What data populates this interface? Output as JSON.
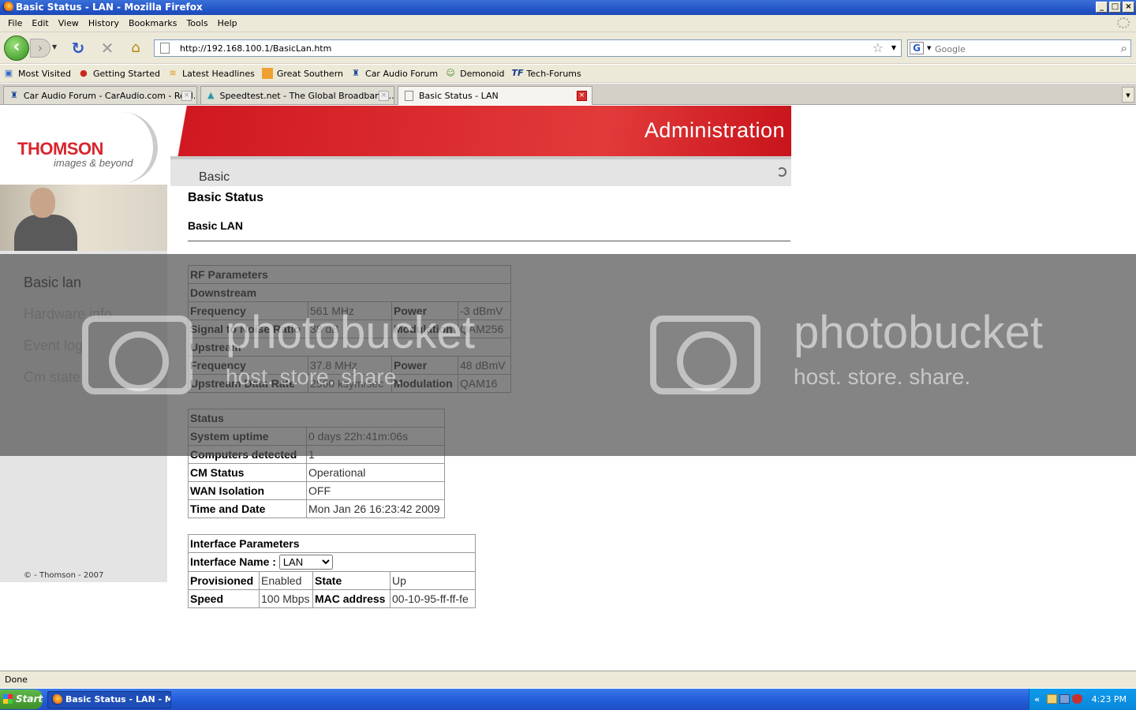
{
  "window": {
    "title": "Basic Status - LAN - Mozilla Firefox"
  },
  "menu": [
    "File",
    "Edit",
    "View",
    "History",
    "Bookmarks",
    "Tools",
    "Help"
  ],
  "address": {
    "url": "http://192.168.100.1/BasicLan.htm"
  },
  "search": {
    "placeholder": "Google"
  },
  "bookmarks": [
    "Most Visited",
    "Getting Started",
    "Latest Headlines",
    "Great Southern",
    "Car Audio Forum",
    "Demonoid",
    "Tech-Forums"
  ],
  "tabs": [
    "Car Audio Forum - CarAudio.com - Repl...",
    "Speedtest.net - The Global Broadband ...",
    "Basic Status - LAN"
  ],
  "header": {
    "brand": "THOMSON",
    "tagline": "images & beyond",
    "banner": "Administration",
    "section": "Basic"
  },
  "sidebar": {
    "items": [
      "Basic lan",
      "Hardware info",
      "Event log",
      "Cm state"
    ],
    "copyright": "© - Thomson - 2007"
  },
  "page": {
    "title": "Basic Status",
    "subtitle": "Basic LAN"
  },
  "rf": {
    "heading": "RF Parameters",
    "downstream": "Downstream",
    "ds_freq_label": "Frequency",
    "ds_freq": "561 MHz",
    "ds_power_label": "Power",
    "ds_power": "-3 dBmV",
    "snr_label": "Signal to Noise Ratio",
    "snr": "38 dB",
    "ds_mod_label": "Modulation",
    "ds_mod": "QAM256",
    "upstream": "Upstream",
    "us_freq_label": "Frequency",
    "us_freq": "37.8 MHz",
    "us_power_label": "Power",
    "us_power": "48 dBmV",
    "us_rate_label": "Upstream Data Rate",
    "us_rate": "2560 ksym/sec",
    "us_mod_label": "Modulation",
    "us_mod": "QAM16"
  },
  "status": {
    "heading": "Status",
    "uptime_label": "System uptime",
    "uptime": "0 days 22h:41m:06s",
    "computers_label": "Computers detected",
    "computers": "1",
    "cm_label": "CM Status",
    "cm": "Operational",
    "wan_label": "WAN Isolation",
    "wan": "OFF",
    "time_label": "Time and Date",
    "time": "Mon Jan 26 16:23:42 2009"
  },
  "iface": {
    "heading": "Interface Parameters",
    "name_label": "Interface Name :",
    "name_value": "LAN",
    "prov_label": "Provisioned",
    "prov": "Enabled",
    "state_label": "State",
    "state": "Up",
    "speed_label": "Speed",
    "speed": "100 Mbps",
    "mac_label": "MAC address",
    "mac": "00-10-95-ff-ff-fe"
  },
  "watermark": {
    "brand": "photobucket",
    "slogan": "host. store. share."
  },
  "statusbar": {
    "text": "Done"
  },
  "taskbar": {
    "start": "Start",
    "task": "Basic Status - LAN - M...",
    "tray_arrow": "«",
    "clock": "4:23 PM"
  }
}
